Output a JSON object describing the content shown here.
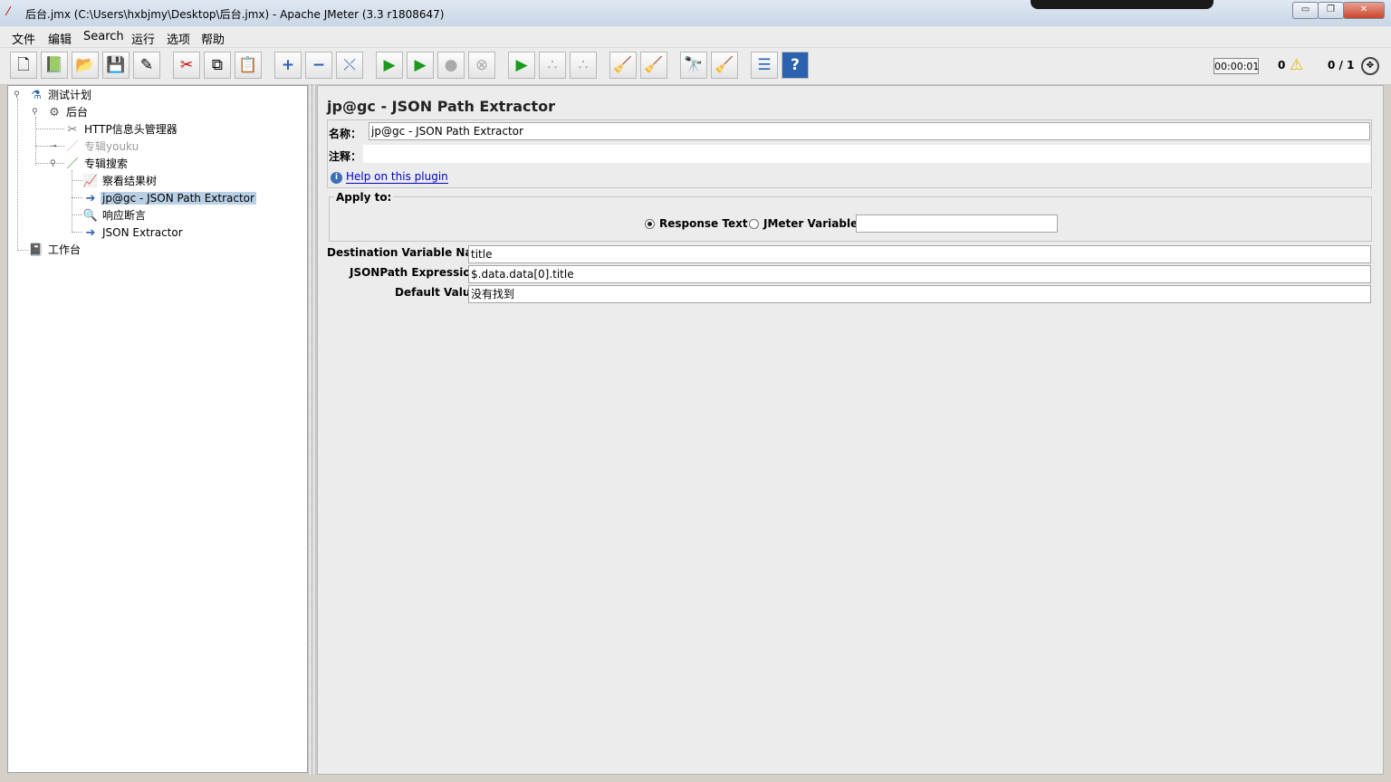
{
  "window": {
    "title": "后台.jmx (C:\\Users\\hxbjmy\\Desktop\\后台.jmx) - Apache JMeter (3.3 r1808647)",
    "minimize": "▭",
    "restore": "❐",
    "close": "✕"
  },
  "menu": [
    "文件",
    "编辑",
    "Search",
    "运行",
    "选项",
    "帮助"
  ],
  "toolbar": {
    "buttons": [
      {
        "name": "new-button",
        "glyph": "🗋"
      },
      {
        "name": "templates-button",
        "glyph": "📗"
      },
      {
        "name": "open-button",
        "glyph": "📂"
      },
      {
        "name": "save-button",
        "glyph": "💾"
      },
      {
        "name": "save-as-button",
        "glyph": "✎"
      },
      {
        "name": "cut-button",
        "glyph": "✂"
      },
      {
        "name": "copy-button",
        "glyph": "⧉"
      },
      {
        "name": "paste-button",
        "glyph": "📋"
      },
      {
        "name": "expand-all-button",
        "glyph": "+"
      },
      {
        "name": "collapse-all-button",
        "glyph": "−"
      },
      {
        "name": "toggle-button",
        "glyph": "⤬"
      },
      {
        "name": "start-button",
        "glyph": "▶"
      },
      {
        "name": "start-no-pauses-button",
        "glyph": "▶"
      },
      {
        "name": "stop-button",
        "glyph": "●"
      },
      {
        "name": "shutdown-button",
        "glyph": "⊗"
      },
      {
        "name": "remote-start-button",
        "glyph": "▶"
      },
      {
        "name": "remote-stop-button",
        "glyph": "∴"
      },
      {
        "name": "remote-shutdown-button",
        "glyph": "∴"
      },
      {
        "name": "clear-button",
        "glyph": "🧹"
      },
      {
        "name": "clear-all-button",
        "glyph": "🧹"
      },
      {
        "name": "search-button",
        "glyph": "🔭"
      },
      {
        "name": "reset-search-button",
        "glyph": "🧹"
      },
      {
        "name": "function-helper-button",
        "glyph": "☰"
      },
      {
        "name": "help-button",
        "glyph": "?"
      }
    ],
    "timer": "00:00:01",
    "warnings": "0",
    "threads": "0 / 1"
  },
  "tree": {
    "nodes": [
      {
        "label": "测试计划",
        "icon": "⚗"
      },
      {
        "label": "后台",
        "icon": "⚙"
      },
      {
        "label": "HTTP信息头管理器",
        "icon": "✂"
      },
      {
        "label": "专辑youku",
        "icon": "／"
      },
      {
        "label": "专辑搜索",
        "icon": "／"
      },
      {
        "label": "察看结果树",
        "icon": "📈"
      },
      {
        "label": "jp@gc - JSON Path Extractor",
        "icon": "➔"
      },
      {
        "label": "响应断言",
        "icon": "🔍"
      },
      {
        "label": "JSON Extractor",
        "icon": "➔"
      },
      {
        "label": "工作台",
        "icon": "📓"
      }
    ]
  },
  "panel": {
    "title": "jp@gc - JSON Path Extractor",
    "name_label": "名称：",
    "name_value": "jp@gc - JSON Path Extractor",
    "comment_label": "注释：",
    "comment_value": "",
    "help_link": "Help on this plugin",
    "apply_to": "Apply to:",
    "radio_response_text": "Response Text",
    "radio_jmeter_variable": "JMeter Variable:",
    "jmeter_variable_value": "",
    "dest_label": "Destination Variable Name:",
    "dest_value": "title",
    "jsonpath_label": "JSONPath Expression:",
    "jsonpath_value": "$.data.data[0].title",
    "default_label": "Default Value:",
    "default_value": "没有找到"
  }
}
